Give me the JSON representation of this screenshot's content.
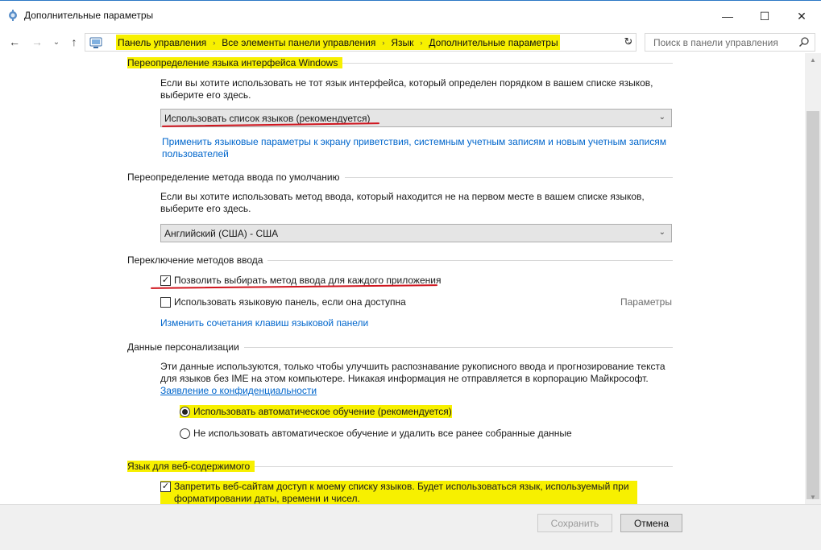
{
  "window": {
    "title": "Дополнительные параметры",
    "min_glyph": "—",
    "max_glyph": "☐",
    "close_glyph": "✕"
  },
  "nav": {
    "back_glyph": "←",
    "forward_glyph": "→",
    "dropdown_glyph": "⌄",
    "up_glyph": "↑",
    "refresh_glyph": "↻",
    "breadcrumbs": [
      "Панель управления",
      "Все элементы панели управления",
      "Язык",
      "Дополнительные параметры"
    ],
    "separator_glyph": "›",
    "search_placeholder": "Поиск в панели управления"
  },
  "sections": {
    "ui_language": {
      "heading": "Переопределение языка интерфейса Windows",
      "description": "Если вы хотите использовать не тот язык интерфейса, который определен порядком в вашем списке языков, выберите его здесь.",
      "dropdown_value": "Использовать список языков (рекомендуется)",
      "apply_link": "Применить языковые параметры к экрану приветствия, системным учетным записям и новым учетным записям пользователей"
    },
    "input_method": {
      "heading": "Переопределение метода ввода по умолчанию",
      "description": "Если вы хотите использовать метод ввода, который находится не на первом месте в вашем списке языков, выберите его здесь.",
      "dropdown_value": "Английский (США) - США"
    },
    "switching": {
      "heading": "Переключение методов ввода",
      "per_app_checkbox": "Позволить выбирать метод ввода для каждого приложения",
      "per_app_checked": true,
      "language_bar_checkbox": "Использовать языковую панель, если она доступна",
      "language_bar_checked": false,
      "options_link": "Параметры",
      "hotkeys_link": "Изменить сочетания клавиш языковой панели"
    },
    "personalization": {
      "heading": "Данные персонализации",
      "description": "Эти данные используются, только чтобы улучшить распознавание рукописного ввода и прогнозирование текста для языков без IME на этом компьютере. Никакая информация не отправляется в корпорацию Майкрософт.",
      "privacy_link": "Заявление о конфиденциальности",
      "radio_auto": "Использовать автоматическое обучение (рекомендуется)",
      "radio_auto_selected": true,
      "radio_off": "Не использовать автоматическое обучение и удалить все ранее собранные данные"
    },
    "web_content": {
      "heading": "Язык для веб-содержимого",
      "block_checkbox": "Запретить веб-сайтам доступ к моему списку языков. Будет использоваться язык, используемый при форматировании даты, времени и чисел.",
      "block_checked": true
    }
  },
  "footer": {
    "save_label": "Сохранить",
    "cancel_label": "Отмена"
  },
  "colors": {
    "highlight": "#f7f000",
    "annotation_red": "#d0161f",
    "link": "#0066cc"
  }
}
